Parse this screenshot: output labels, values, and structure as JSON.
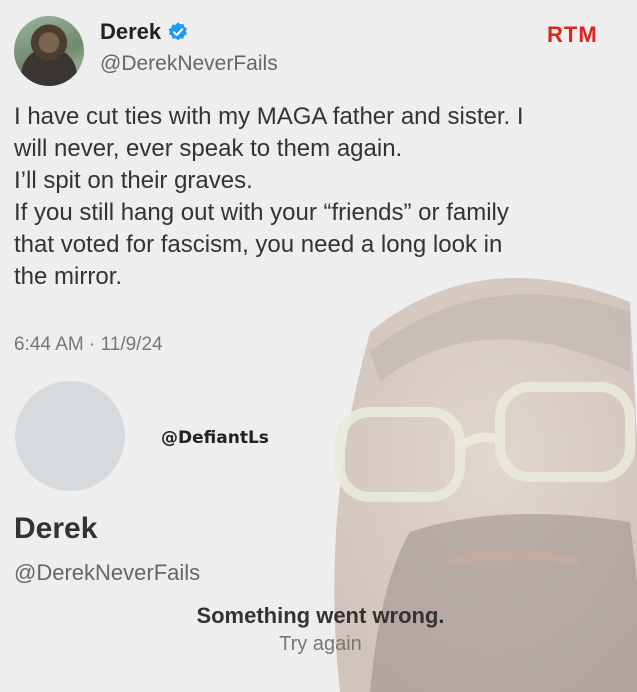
{
  "tweet": {
    "author_name": "Derek",
    "author_handle": "@DerekNeverFails",
    "lines": [
      "I have cut ties with my MAGA father and sister.  I",
      "will never, ever speak to them again.",
      "I’ll spit on their graves.",
      "If you still hang out with your “friends” or family",
      "that voted for fascism, you need a long look in",
      "the mirror."
    ],
    "timestamp": "6:44 AM · 11/9/24"
  },
  "logo": "RTM",
  "watermark": "@DefiantLs",
  "profile": {
    "name": "Derek",
    "handle": "@DerekNeverFails",
    "error_title": "Something went wrong.",
    "retry_label": "Try again"
  },
  "colors": {
    "logo": "#e0231c",
    "verified": "#1d9bf0",
    "avatar_placeholder": "#d6dadd"
  },
  "icons": {
    "verified": "verified-badge-icon"
  }
}
